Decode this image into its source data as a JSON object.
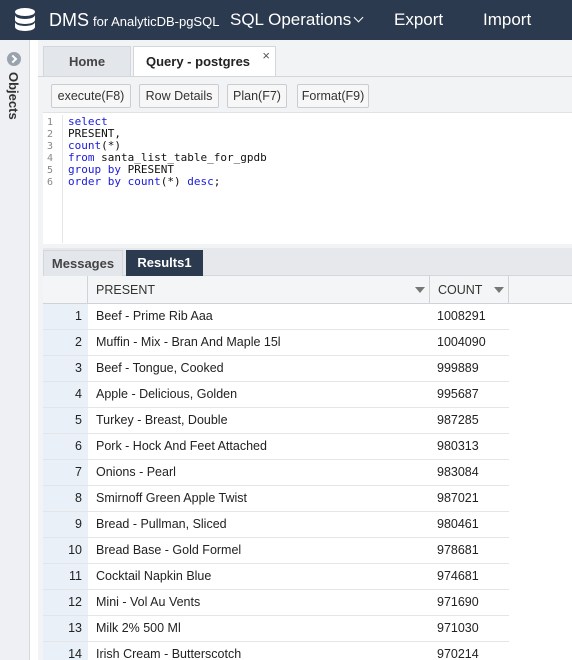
{
  "header": {
    "app_name": "DMS",
    "app_sub": "for AnalyticDB-pgSQL",
    "nav": {
      "sql_ops": "SQL Operations",
      "export": "Export",
      "import": "Import"
    }
  },
  "sidebar": {
    "objects_label": "Objects"
  },
  "tabs": {
    "home": "Home",
    "query": "Query - postgres",
    "close": "×"
  },
  "toolbar": {
    "execute": "execute(F8)",
    "row_details": "Row Details",
    "plan": "Plan(F7)",
    "format": "Format(F9)"
  },
  "editor": {
    "line_numbers": [
      "1",
      "2",
      "3",
      "4",
      "5",
      "6"
    ],
    "lines": [
      {
        "kw": "select",
        "rest": ""
      },
      {
        "kw": "",
        "rest": "PRESENT,"
      },
      {
        "kw": "count",
        "rest": "(*)"
      },
      {
        "kw": "from",
        "rest": " santa_list_table_for_gpdb"
      },
      {
        "kw": "group by",
        "rest": " PRESENT"
      },
      {
        "kw": "order by count",
        "rest": "(*) ",
        "kw2": "desc",
        "rest2": ";"
      }
    ]
  },
  "result_tabs": {
    "messages": "Messages",
    "results": "Results1"
  },
  "grid": {
    "columns": {
      "present": "PRESENT",
      "count": "COUNT"
    },
    "rows": [
      {
        "idx": "1",
        "present": "Beef - Prime Rib Aaa",
        "count": "1008291"
      },
      {
        "idx": "2",
        "present": "Muffin - Mix - Bran And Maple 15l",
        "count": "1004090"
      },
      {
        "idx": "3",
        "present": "Beef - Tongue, Cooked",
        "count": "999889"
      },
      {
        "idx": "4",
        "present": "Apple - Delicious, Golden",
        "count": "995687"
      },
      {
        "idx": "5",
        "present": "Turkey - Breast, Double",
        "count": "987285"
      },
      {
        "idx": "6",
        "present": "Pork - Hock And Feet Attached",
        "count": "980313"
      },
      {
        "idx": "7",
        "present": "Onions - Pearl",
        "count": "983084"
      },
      {
        "idx": "8",
        "present": "Smirnoff Green Apple Twist",
        "count": "987021"
      },
      {
        "idx": "9",
        "present": "Bread - Pullman, Sliced",
        "count": "980461"
      },
      {
        "idx": "10",
        "present": "Bread Base - Gold Formel",
        "count": "978681"
      },
      {
        "idx": "11",
        "present": "Cocktail Napkin Blue",
        "count": "974681"
      },
      {
        "idx": "12",
        "present": "Mini - Vol Au Vents",
        "count": "971690"
      },
      {
        "idx": "13",
        "present": "Milk 2% 500 Ml",
        "count": "971030"
      },
      {
        "idx": "14",
        "present": "Irish Cream - Butterscotch",
        "count": "970214"
      }
    ]
  },
  "colors": {
    "topbar": "#2b3a4e",
    "keyword": "#1a1adb",
    "active_tab": "#2b3a4e"
  }
}
